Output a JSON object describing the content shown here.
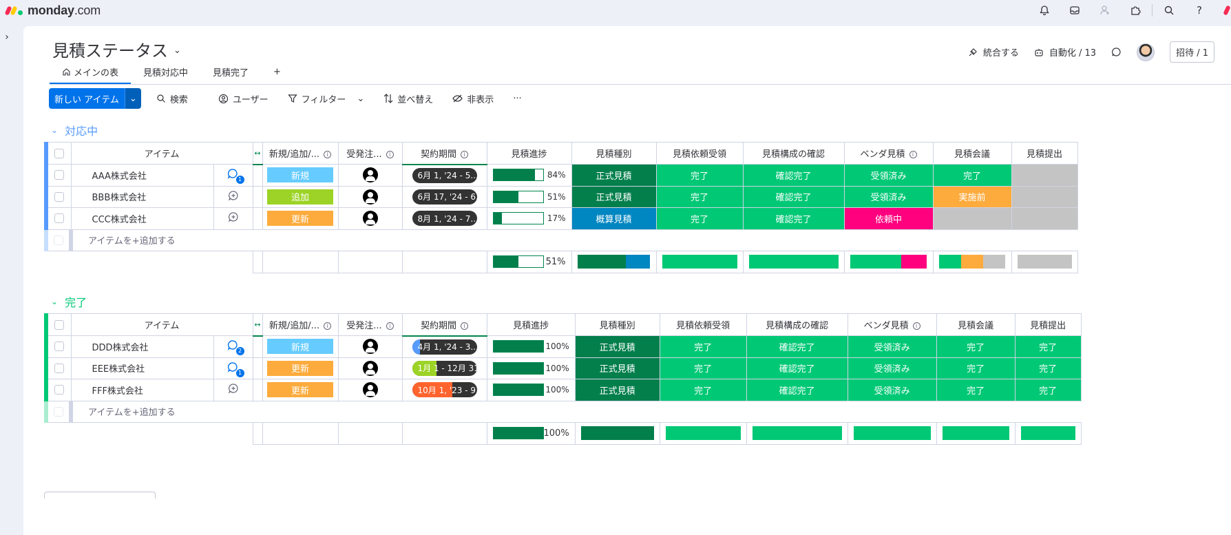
{
  "app": {
    "brand": "monday",
    "brand_suffix": ".com"
  },
  "board": {
    "title": "見積ステータス"
  },
  "header": {
    "integrate": "統合する",
    "automate": "自動化 / 13",
    "invite": "招待 / 1"
  },
  "tabs": [
    {
      "label": "メインの表"
    },
    {
      "label": "見積対応中"
    },
    {
      "label": "見積完了"
    },
    {
      "label": "+"
    }
  ],
  "toolbar": {
    "new_item": "新しい アイテム",
    "search": "検索",
    "person": "ユーザー",
    "filter": "フィルター",
    "sort": "並べ替え",
    "hide": "非表示",
    "more": "···"
  },
  "columns": [
    "アイテム",
    "新規/追加/...",
    "受発注...",
    "契約期間",
    "見積進捗",
    "見積種別",
    "見積依頼受領",
    "見積構成の確認",
    "ベンダ見積",
    "見積会議",
    "見積提出"
  ],
  "colors": {
    "brand": "#0073ea",
    "done": "#00c875",
    "dark_green": "#037f4c",
    "blue": "#0086c0",
    "orange": "#fdab3d",
    "pink": "#ff007f",
    "gray": "#c4c4c4",
    "sky": "#66ccff",
    "lime": "#9cd326",
    "group1": "#579bfc",
    "group2": "#00c875"
  },
  "add_item": "アイテムを+追加する",
  "groups": [
    {
      "title": "対応中",
      "color": "#579bfc",
      "rows": [
        {
          "name": "AAA株式会社",
          "updates": "1",
          "label": "新規",
          "label_color": "#66ccff",
          "timeline": "6月 1, '24 - 5...",
          "tl_fill": 0,
          "progress": 84,
          "progress_text": "84%",
          "kind": "正式見積",
          "kind_color": "#037f4c",
          "s1": "完了",
          "s2": "確認完了",
          "s3": "受領済み",
          "s3_color": "#00c875",
          "s4": "完了",
          "s4_color": "#00c875",
          "s5": "",
          "s5_color": "#c4c4c4"
        },
        {
          "name": "BBB株式会社",
          "updates": "",
          "label": "追加",
          "label_color": "#9cd326",
          "timeline": "6月 17, '24 - 6...",
          "tl_fill": 0,
          "progress": 51,
          "progress_text": "51%",
          "kind": "正式見積",
          "kind_color": "#037f4c",
          "s1": "完了",
          "s2": "確認完了",
          "s3": "受領済み",
          "s3_color": "#00c875",
          "s4": "実施前",
          "s4_color": "#fdab3d",
          "s5": "",
          "s5_color": "#c4c4c4"
        },
        {
          "name": "CCC株式会社",
          "updates": "",
          "label": "更新",
          "label_color": "#fdab3d",
          "timeline": "8月 1, '24 - 7...",
          "tl_fill": 0,
          "progress": 17,
          "progress_text": "17%",
          "kind": "概算見積",
          "kind_color": "#0086c0",
          "s1": "完了",
          "s2": "確認完了",
          "s3": "依頼中",
          "s3_color": "#ff007f",
          "s4": "",
          "s4_color": "#c4c4c4",
          "s5": "",
          "s5_color": "#c4c4c4"
        }
      ],
      "summary": {
        "progress": 51,
        "progress_text": "51%"
      }
    },
    {
      "title": "完了",
      "color": "#00c875",
      "rows": [
        {
          "name": "DDD株式会社",
          "updates": "2",
          "label": "新規",
          "label_color": "#66ccff",
          "timeline": "4月 1, '24 - 3...",
          "tl_fill": 12,
          "tl_color": "#579bfc",
          "progress": 100,
          "progress_text": "100%",
          "kind": "正式見積",
          "kind_color": "#037f4c",
          "s1": "完了",
          "s2": "確認完了",
          "s3": "受領済み",
          "s3_color": "#00c875",
          "s4": "完了",
          "s4_color": "#00c875",
          "s5": "完了",
          "s5_color": "#00c875"
        },
        {
          "name": "EEE株式会社",
          "updates": "1",
          "label": "更新",
          "label_color": "#fdab3d",
          "timeline": "1月 1 - 12月 31",
          "tl_fill": 38,
          "tl_color": "#9cd326",
          "progress": 100,
          "progress_text": "100%",
          "kind": "正式見積",
          "kind_color": "#037f4c",
          "s1": "完了",
          "s2": "確認完了",
          "s3": "受領済み",
          "s3_color": "#00c875",
          "s4": "完了",
          "s4_color": "#00c875",
          "s5": "完了",
          "s5_color": "#00c875"
        },
        {
          "name": "FFF株式会社",
          "updates": "",
          "label": "更新",
          "label_color": "#fdab3d",
          "timeline": "10月 1, '23 - 9...",
          "tl_fill": 62,
          "tl_color": "#ff642e",
          "progress": 100,
          "progress_text": "100%",
          "kind": "正式見積",
          "kind_color": "#037f4c",
          "s1": "完了",
          "s2": "確認完了",
          "s3": "受領済み",
          "s3_color": "#00c875",
          "s4": "完了",
          "s4_color": "#00c875",
          "s5": "完了",
          "s5_color": "#00c875"
        }
      ],
      "summary": {
        "progress": 100,
        "progress_text": "100%"
      }
    }
  ]
}
